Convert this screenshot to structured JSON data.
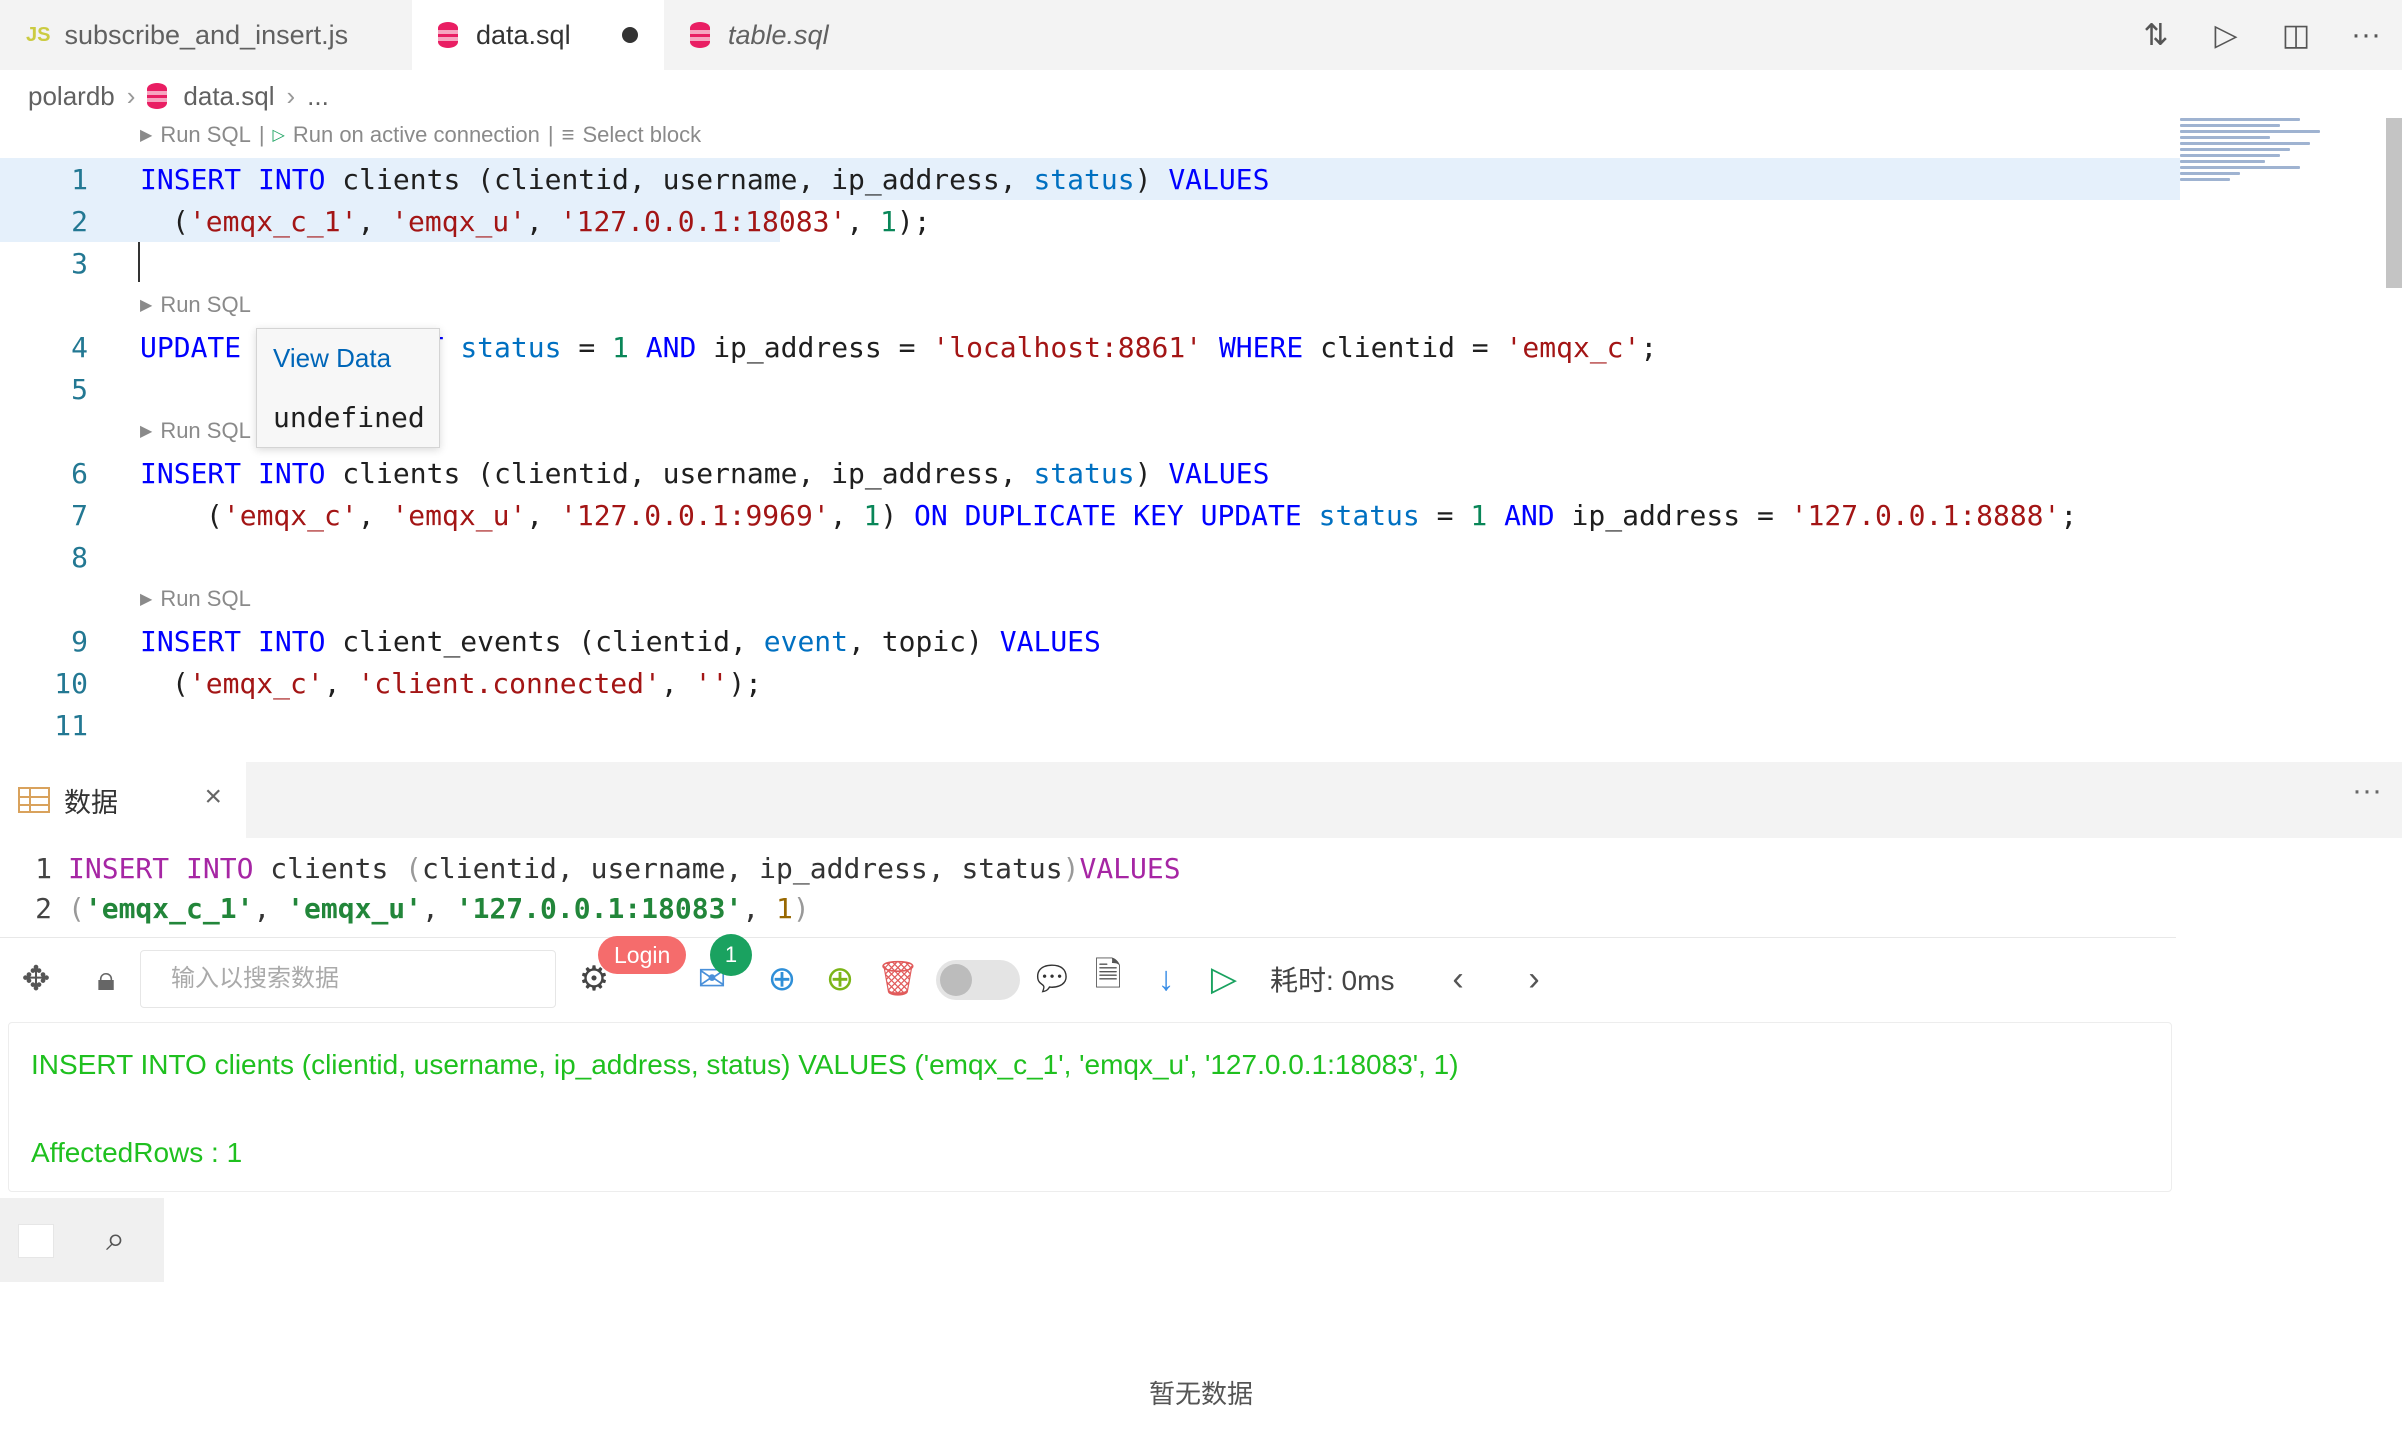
{
  "tabs": [
    {
      "icon": "JS",
      "label": "subscribe_and_insert.js"
    },
    {
      "label": "data.sql"
    },
    {
      "label": "table.sql"
    }
  ],
  "breadcrumb": {
    "root": "polardb",
    "file": "data.sql",
    "tail": "..."
  },
  "codelens": {
    "run_sql": "Run SQL",
    "run_active": "Run on active connection",
    "select_block": "Select block",
    "sep": "|"
  },
  "editor": {
    "line_numbers": [
      "1",
      "2",
      "3",
      "4",
      "5",
      "6",
      "7",
      "8",
      "9",
      "10",
      "11"
    ]
  },
  "popup": {
    "view_data": "View Data",
    "value": "undefined"
  },
  "panel": {
    "tab_label": "数据",
    "close": "×",
    "more": "···"
  },
  "preview": {
    "line1_num": "1",
    "line2_num": "2"
  },
  "toolbar": {
    "search_placeholder": "输入以搜索数据",
    "login": "Login",
    "badge_count": "1",
    "timer": "耗时: 0ms"
  },
  "result": {
    "statement": "INSERT INTO clients (clientid, username, ip_address, status) VALUES ('emqx_c_1', 'emqx_u', '127.0.0.1:18083', 1)",
    "affected": "AffectedRows : 1"
  },
  "empty_text": "暂无数据",
  "colors": {
    "keyword": "#0000ff",
    "string": "#a31515",
    "number": "#098658",
    "success": "#1fc01f",
    "accent": "#e91e63"
  }
}
